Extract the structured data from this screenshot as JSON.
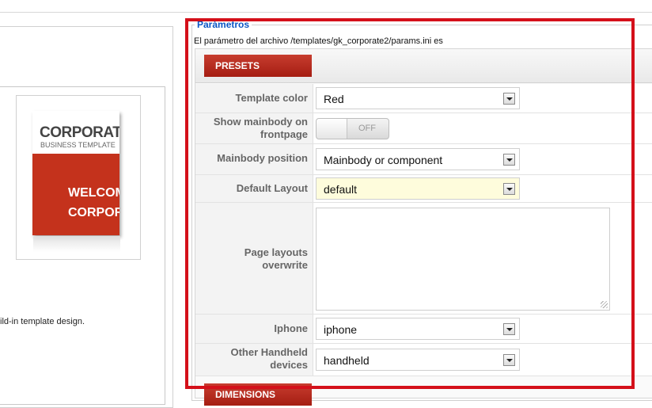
{
  "fieldset_legend": "Parámetros",
  "param_note": "El parámetro del archivo /templates/gk_corporate2/params.ini es",
  "tabs": {
    "presets": "PRESETS",
    "dimensions": "DIMENSIONS"
  },
  "thumbnail": {
    "title": "CORPORATE",
    "subtitle": "BUSINESS TEMPLATE",
    "welcome_line1": "WELCOM",
    "welcome_line2": "CORPOR"
  },
  "description_fragment": "ild-in template design.",
  "fields": {
    "template_color": {
      "label": "Template color",
      "value": "Red"
    },
    "show_mainbody": {
      "label_line1": "Show mainbody on",
      "label_line2": "frontpage",
      "toggle_text": "OFF",
      "enabled": false
    },
    "mainbody_position": {
      "label": "Mainbody position",
      "value": "Mainbody or component"
    },
    "default_layout": {
      "label": "Default Layout",
      "value": "default"
    },
    "page_layouts": {
      "label_line1": "Page layouts",
      "label_line2": "overwrite",
      "value": ""
    },
    "iphone": {
      "label": "Iphone",
      "value": "iphone"
    },
    "handheld": {
      "label_line1": "Other Handheld",
      "label_line2": "devices",
      "value": "handheld"
    }
  },
  "colors": {
    "tab_red": "#b52a1c",
    "highlight_red": "#d4101a",
    "legend_blue": "#0b55c4"
  }
}
